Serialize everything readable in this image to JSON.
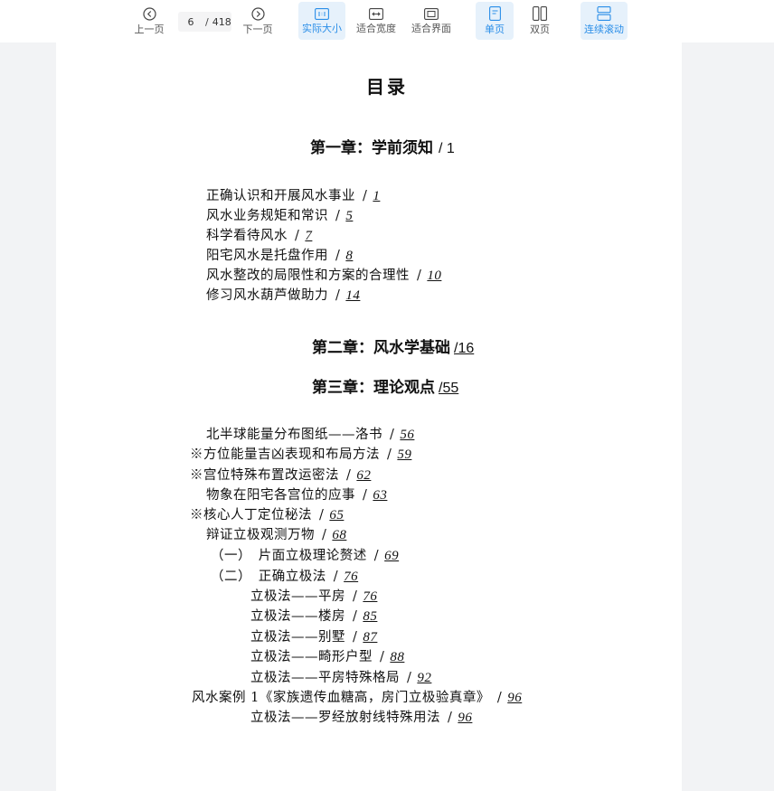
{
  "toolbar": {
    "prev_label": "上一页",
    "next_label": "下一页",
    "current_page": "6",
    "page_sep": "/",
    "total_pages": "418",
    "actual_size_label": "实际大小",
    "fit_width_label": "适合宽度",
    "fit_page_label": "适合界面",
    "single_page_label": "单页",
    "double_page_label": "双页",
    "continuous_label": "连续滚动",
    "accent_color": "#2a8ee8"
  },
  "toc": {
    "title": "目录",
    "chapter1": {
      "title": "第一章：学前须知",
      "page": "/ 1"
    },
    "chapter1_entries": [
      {
        "text": "正确认识和开展风水事业",
        "page": "1"
      },
      {
        "text": "风水业务规矩和常识",
        "page": "5"
      },
      {
        "text": "科学看待风水",
        "page": "7"
      },
      {
        "text": "阳宅风水是托盘作用",
        "page": "8"
      },
      {
        "text": "风水整改的局限性和方案的合理性",
        "page": "10"
      },
      {
        "text": "修习风水葫芦做助力",
        "page": "14"
      }
    ],
    "chapter2": {
      "title": "第二章：风水学基础",
      "page": "/16"
    },
    "chapter3": {
      "title": "第三章：理论观点",
      "page": "/55"
    },
    "chapter3_entries": [
      {
        "text": "北半球能量分布图纸——洛书",
        "page": "56"
      },
      {
        "text": "※方位能量吉凶表现和布局方法",
        "page": "59"
      },
      {
        "text": "※宫位特殊布置改运密法",
        "page": "62"
      },
      {
        "text": "物象在阳宅各宫位的应事",
        "page": "63"
      },
      {
        "text": "※核心人丁定位秘法",
        "page": "65"
      },
      {
        "text": "辩证立极观测万物",
        "page": "68"
      },
      {
        "text": "（一）　片面立极理论赘述",
        "page": "69"
      },
      {
        "text": "（二）　正确立极法",
        "page": "76"
      },
      {
        "text": "立极法——平房",
        "page": "76"
      },
      {
        "text": "立极法——楼房",
        "page": "85"
      },
      {
        "text": "立极法——别墅",
        "page": "87"
      },
      {
        "text": "立极法——畸形户型",
        "page": "88"
      },
      {
        "text": "立极法——平房特殊格局",
        "page": "92"
      },
      {
        "text": "风水案例 1《家族遗传血糖高，房门立极验真章》",
        "page": "96"
      },
      {
        "text": "立极法——罗经放射线特殊用法",
        "page": "96"
      }
    ]
  }
}
